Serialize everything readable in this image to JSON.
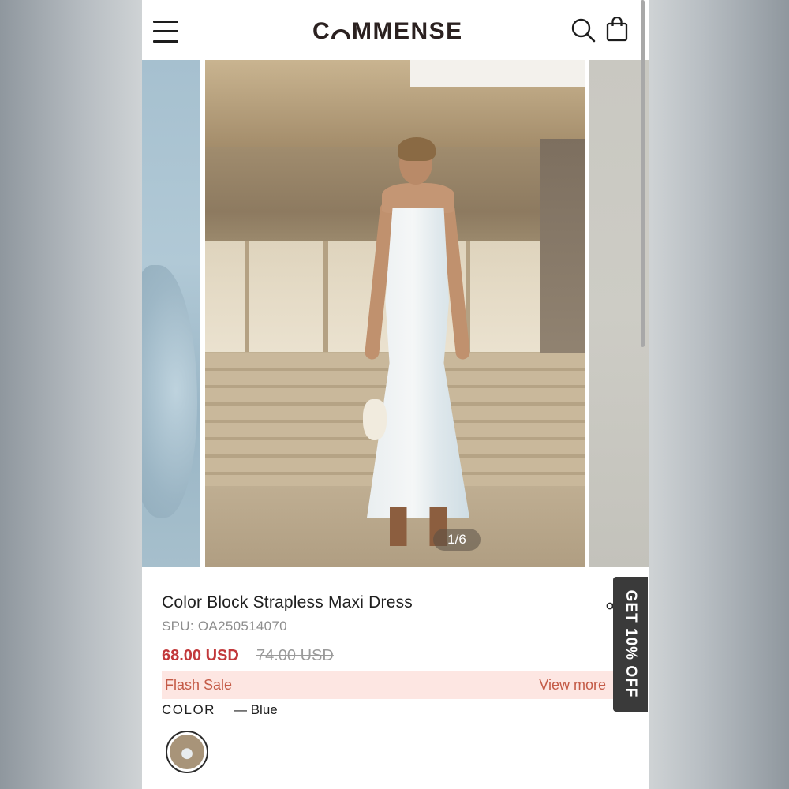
{
  "header": {
    "logo": "CꟷMMENSE",
    "logo_text": "COMMENSE",
    "menu_icon": "hamburger-menu-icon",
    "search_icon": "search-icon",
    "bag_icon": "shopping-bag-icon"
  },
  "gallery": {
    "counter": "1/6",
    "current_index": 1,
    "total": 6
  },
  "product": {
    "title": "Color Block Strapless Maxi Dress",
    "spu": "SPU: OA250514070",
    "price": "68.00 USD",
    "original_price": "74.00 USD",
    "flash_sale_label": "Flash Sale",
    "view_more_label": "View more",
    "color_label": "COLOR",
    "color_value": "— Blue",
    "share_icon": "share-icon"
  },
  "promo": {
    "label": "GET 10% OFF"
  },
  "colors": {
    "price": "#c2393b",
    "flash_bg": "#fde6e2",
    "flash_text": "#c45b47",
    "promo_bg": "#3a3a3a",
    "logo": "#2b2120"
  }
}
